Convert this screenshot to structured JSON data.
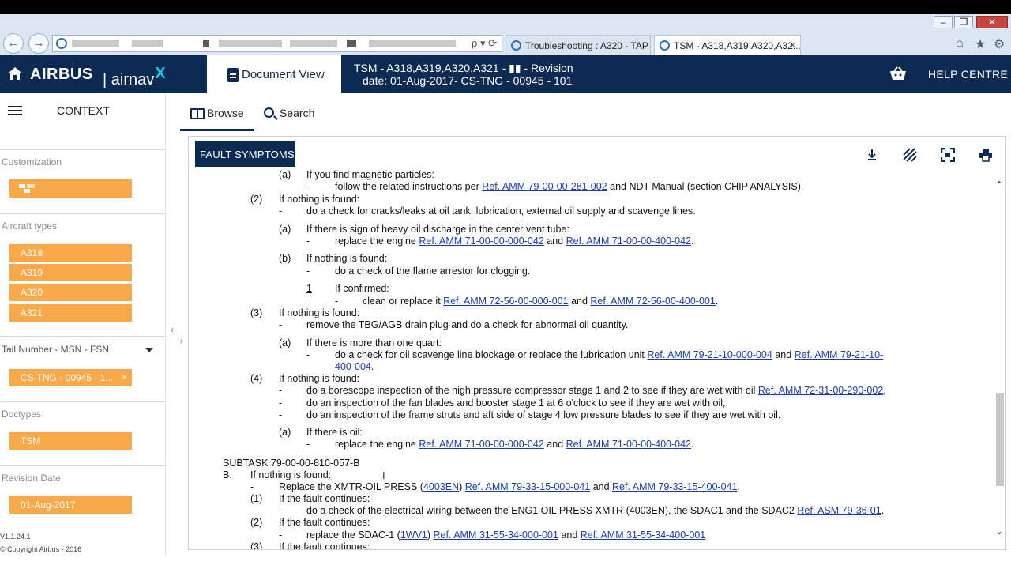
{
  "browser": {
    "tabs": [
      {
        "label": "Troubleshooting : A320 - TAP",
        "active": false
      },
      {
        "label": "TSM - A318,A319,A320,A32...",
        "active": true
      }
    ],
    "close_glyph": "×",
    "address_icons": "ρ ▾ ⟳"
  },
  "header": {
    "brand": "AIRBUS",
    "product": "| airnav",
    "product_sup": "X",
    "document_view": "Document View",
    "revision_line1": "TSM - A318,A319,A320,A321 - ▮▮ - Revision",
    "revision_line2": "date: 01-Aug-2017- CS-TNG - 00945 - 101",
    "help": "HELP CENTRE"
  },
  "sidebar": {
    "context": "CONTEXT",
    "customization_title": "Customization",
    "aircraft_types_title": "Aircraft types",
    "aircraft_types": [
      "A318",
      "A319",
      "A320",
      "A321"
    ],
    "tail_title": "Tail Number - MSN - FSN",
    "tail_value": "CS-TNG - 00945 - 1...",
    "tail_clear": "×",
    "doctypes_title": "Doctypes",
    "doctype": "TSM",
    "revision_title": "Revision Date",
    "revision_value": "01-Aug-2017",
    "version": "V1.1.24.1",
    "copyright": "© Copyright Airbus - 2016"
  },
  "tabs": {
    "browse": "Browse",
    "search": "Search"
  },
  "panel": {
    "title": "FAULT SYMPTOMS"
  },
  "doc": {
    "l1_a": "(a)",
    "l1_t": "If you find magnetic particles:",
    "l2_d": "-",
    "l2_t": "follow the related instructions per",
    "l2_r": "Ref. AMM 79-00-00-281-002",
    "l2_e": "and NDT Manual (section CHIP ANALYSIS).",
    "l3_n": "(2)",
    "l3_t": "If nothing is found:",
    "l4_d": "-",
    "l4_t": "do a check for cracks/leaks at oil tank, lubrication, external oil supply and scavenge lines.",
    "l5_a": "(a)",
    "l5_t": "If there is sign of heavy oil discharge in the center vent tube:",
    "l6_d": "-",
    "l6_t": "replace the engine",
    "l6_r1": "Ref. AMM 71-00-00-000-042",
    "l6_m": "and",
    "l6_r2": "Ref. AMM 71-00-00-400-042",
    "l6_e": ".",
    "l7_a": "(b)",
    "l7_t": "If nothing is found:",
    "l8_d": "-",
    "l8_t": "do a check of the flame arrestor for clogging.",
    "l9_n": "1",
    "l9_t": "If confirmed:",
    "l10_d": "-",
    "l10_t": "clean or replace it",
    "l10_r1": "Ref. AMM 72-56-00-000-001",
    "l10_m": "and",
    "l10_r2": "Ref. AMM 72-56-00-400-001",
    "l10_e": ".",
    "l11_n": "(3)",
    "l11_t": "If nothing is found:",
    "l12_d": "-",
    "l12_t": "remove the TBG/AGB drain plug and do a check for abnormal oil quantity.",
    "l13_a": "(a)",
    "l13_t": "If there is more than one quart:",
    "l14_d": "-",
    "l14_t": "do a check for oil scavenge line blockage or replace the lubrication unit",
    "l14_r1": "Ref. AMM 79-21-10-000-004",
    "l14_m": "and",
    "l14_r2a": "Ref. AMM 79-21-10-",
    "l14_r2b": "400-004",
    "l14_e": ".",
    "l15_n": "(4)",
    "l15_t": "If nothing is found:",
    "l16_d": "-",
    "l16_t": "do a borescope inspection of the high pressure compressor stage 1 and 2 to see if they are wet with oil",
    "l16_r": "Ref. AMM 72-31-00-290-002",
    "l16_e": ",",
    "l17_d": "-",
    "l17_t": "do an inspection of the fan blades and booster stage 1 at 6 o'clock to see if they are wet with oil,",
    "l18_d": "-",
    "l18_t": "do an inspection of the frame struts and aft side of stage 4 low pressure blades to see if they are wet with oil.",
    "l19_a": "(a)",
    "l19_t": "If there is oil:",
    "l20_d": "-",
    "l20_t": "replace the engine",
    "l20_r1": "Ref. AMM 71-00-00-000-042",
    "l20_m": "and",
    "l20_r2": "Ref. AMM 71-00-00-400-042",
    "l20_e": ".",
    "subtask": "SUBTASK 79-00-00-810-057-B",
    "lB_n": "B.",
    "lB_t": "If nothing is found:",
    "lB2_d": "-",
    "lB2_t": "Replace the XMTR-OIL PRESS (",
    "lB2_c": "4003EN",
    "lB2_p": ")",
    "lB2_r1": "Ref. AMM 79-33-15-000-041",
    "lB2_m": "and",
    "lB2_r2": "Ref. AMM 79-33-15-400-041",
    "lB2_e": ".",
    "lB3_n": "(1)",
    "lB3_t": "If the fault continues:",
    "lB4_d": "-",
    "lB4_t": "do a check of the electrical wiring between the ENG1 OIL PRESS XMTR (4003EN), the SDAC1 and the SDAC2",
    "lB4_r": "Ref. ASM 79-36-01",
    "lB4_e": ".",
    "lB5_n": "(2)",
    "lB5_t": "If the fault continues:",
    "lB6_d": "-",
    "lB6_t": "replace the SDAC-1 (",
    "lB6_c": "1WV1",
    "lB6_p": ")",
    "lB6_r1": "Ref. AMM 31-55-34-000-001",
    "lB6_m": "and",
    "lB6_r2": "Ref. AMM 31-55-34-400-001",
    "lB7_n": "(3)",
    "lB7_t": "If the fault continues:"
  },
  "colors": {
    "navy": "#0d2b52",
    "orange": "#f9a84a",
    "link": "#1a3bb5",
    "accent": "#22c3ea"
  },
  "icons": [
    "home-icon",
    "document-icon",
    "basket-icon",
    "hamburger-icon",
    "book-icon",
    "search-icon",
    "download-icon",
    "highlight-icon",
    "fullscreen-icon",
    "print-icon",
    "chevron-up-icon",
    "chevron-down-icon",
    "caret-down-icon"
  ]
}
